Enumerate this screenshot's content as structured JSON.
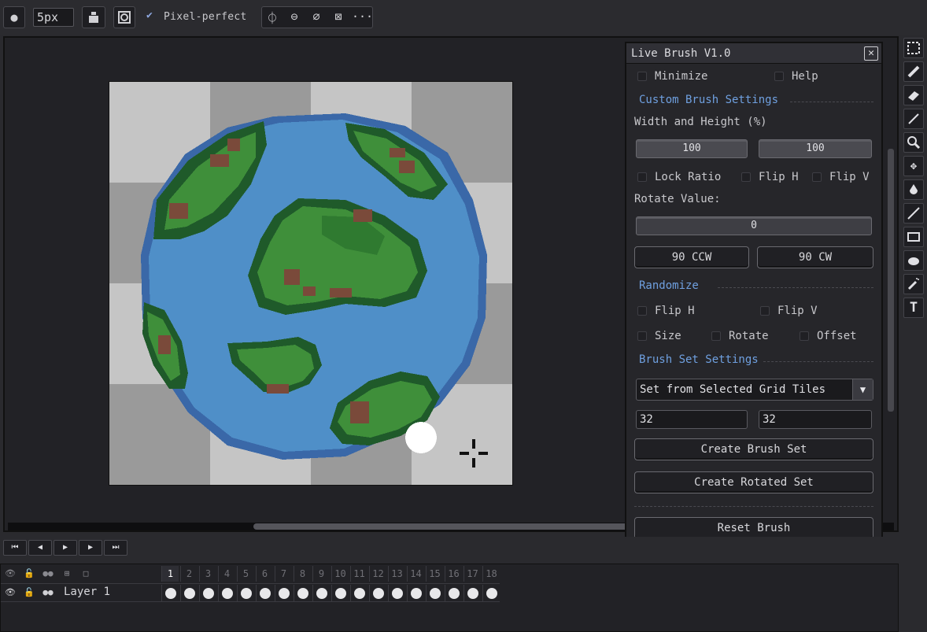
{
  "toolbar": {
    "brush_size": "5px",
    "pixel_perfect_label": "Pixel-perfect",
    "more": "···"
  },
  "panel": {
    "title": "Live Brush V1.0",
    "minimize": "Minimize",
    "help": "Help",
    "custom_section": "Custom Brush Settings",
    "width_height_label": "Width and Height (%)",
    "width_value": "100",
    "height_value": "100",
    "lock_ratio": "Lock Ratio",
    "flip_h": "Flip H",
    "flip_v": "Flip V",
    "rotate_label": "Rotate Value:",
    "rotate_value": "0",
    "ccw_button": "90 CCW",
    "cw_button": "90 CW",
    "randomize_section": "Randomize",
    "rand_flip_h": "Flip H",
    "rand_flip_v": "Flip V",
    "rand_size": "Size",
    "rand_rotate": "Rotate",
    "rand_offset": "Offset",
    "brushset_section": "Brush Set Settings",
    "brushset_mode": "Set from Selected Grid Tiles",
    "tile_w": "32",
    "tile_h": "32",
    "create_set": "Create Brush Set",
    "create_rotated": "Create Rotated Set",
    "reset": "Reset Brush"
  },
  "timeline": {
    "layer_name": "Layer 1",
    "current_frame": 1,
    "frames": [
      "1",
      "2",
      "3",
      "4",
      "5",
      "6",
      "7",
      "8",
      "9",
      "10",
      "11",
      "12",
      "13",
      "14",
      "15",
      "16",
      "17",
      "18"
    ]
  },
  "colors": {
    "water": "#4f8fc8",
    "water_edge": "#3a68a8",
    "grass": "#3f8f3a",
    "grass_dark": "#1f5a2a",
    "dirt": "#7a4a3a",
    "accent": "#6fa0e0"
  }
}
